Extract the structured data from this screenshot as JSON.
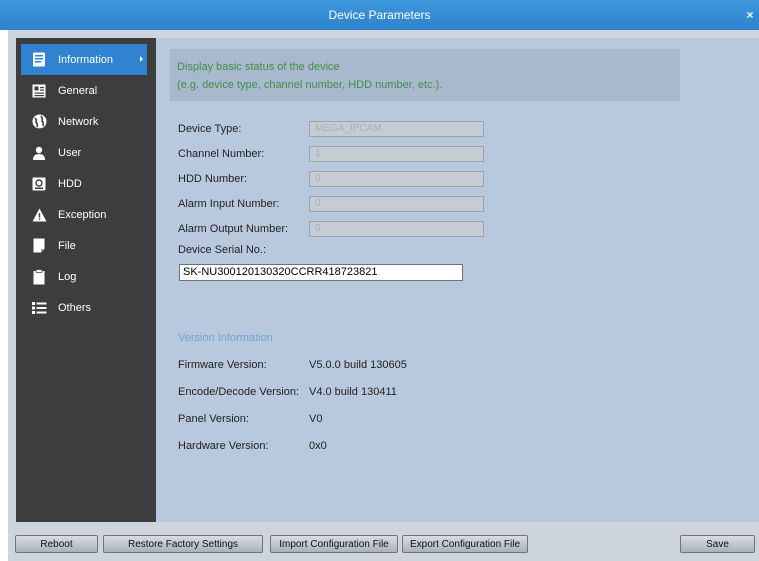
{
  "window": {
    "title": "Device Parameters",
    "close_glyph": "×"
  },
  "sidebar": {
    "items": [
      {
        "label": "Information",
        "icon": "information-icon",
        "active": true
      },
      {
        "label": "General",
        "icon": "general-icon"
      },
      {
        "label": "Network",
        "icon": "network-icon"
      },
      {
        "label": "User",
        "icon": "user-icon"
      },
      {
        "label": "HDD",
        "icon": "hdd-icon"
      },
      {
        "label": "Exception",
        "icon": "exception-icon"
      },
      {
        "label": "File",
        "icon": "file-icon"
      },
      {
        "label": "Log",
        "icon": "log-icon"
      },
      {
        "label": "Others",
        "icon": "others-icon"
      }
    ]
  },
  "info": {
    "line1": "Display basic status of the device",
    "line2": "(e.g. device type, channel number, HDD number, etc.)."
  },
  "fields": {
    "device_type": {
      "label": "Device Type:",
      "value": "MEGA_IPCAM"
    },
    "channel_number": {
      "label": "Channel Number:",
      "value": "1"
    },
    "hdd_number": {
      "label": "HDD Number:",
      "value": "0"
    },
    "alarm_input": {
      "label": "Alarm Input Number:",
      "value": "0"
    },
    "alarm_output": {
      "label": "Alarm Output Number:",
      "value": "0"
    },
    "serial": {
      "label": "Device Serial No.:",
      "value": "SK-NU300120130320CCRR418723821"
    }
  },
  "version": {
    "title": "Version Information",
    "firmware": {
      "label": "Firmware Version:",
      "value": "V5.0.0 build 130605"
    },
    "encode": {
      "label": "Encode/Decode Version:",
      "value": "V4.0 build 130411"
    },
    "panel": {
      "label": "Panel Version:",
      "value": "V0"
    },
    "hardware": {
      "label": "Hardware Version:",
      "value": "0x0"
    }
  },
  "buttons": {
    "reboot": "Reboot",
    "restore": "Restore Factory Settings",
    "import": "Import Configuration File",
    "export": "Export Configuration File",
    "save": "Save"
  }
}
